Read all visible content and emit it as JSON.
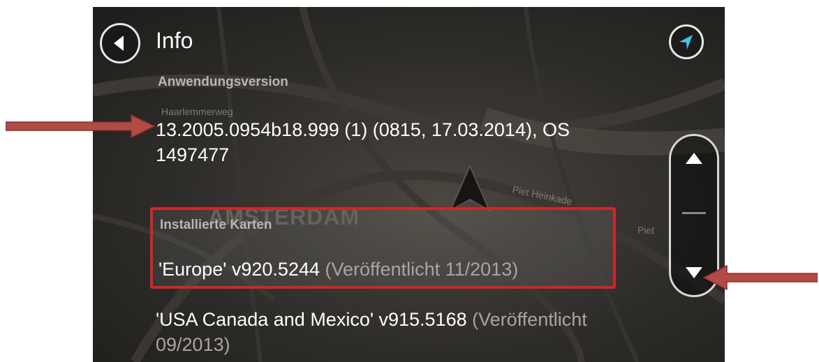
{
  "header": {
    "title": "Info"
  },
  "app_version": {
    "label": "Anwendungsversion",
    "line1": "13.2005.0954b18.999 (1) (0815, 17.03.2014), OS",
    "line2": "1497477"
  },
  "maps": {
    "label": "Installierte Karten",
    "items": [
      {
        "name": "'Europe' v920.5244",
        "published": "(Veröffentlicht 11/2013)"
      },
      {
        "name": "'USA Canada and Mexico' v915.5168",
        "published": "(Veröffentlicht",
        "published_cont": "09/2013)"
      }
    ]
  },
  "map_background": {
    "city": "AMSTERDAM",
    "street1": "Haarlemmerweg",
    "street2": "Piet Heinkade",
    "street3": "Piet"
  },
  "scroll": {
    "position": 0.45
  },
  "icons": {
    "back": "back-arrow-icon",
    "gps": "navigation-arrow-icon",
    "up": "chevron-up-icon",
    "down": "chevron-down-icon"
  },
  "colors": {
    "highlight": "#d0252c",
    "annotation_arrow": "#b24a45",
    "gps_arrow": "#3ec3f0",
    "text": "#ffffff",
    "muted_text": "#a9a6a1"
  }
}
